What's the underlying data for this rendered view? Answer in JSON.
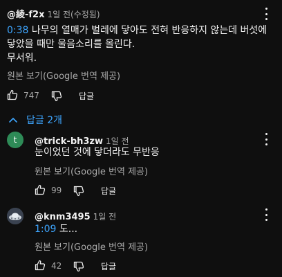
{
  "comment": {
    "author": "@綾-f2x",
    "meta": "1일 전(수정됨)",
    "timestamp": "0:38",
    "text_line1": " 나무의 열매가 벌레에 닿아도 전혀 반응하지 않는데 버섯에",
    "text_line2": "닿았을 때만 울음소리를 올린다.",
    "text_line3": "무서워.",
    "translate_label": "원본 보기(Google 번역 제공)",
    "like_count": "747",
    "reply_label": "답글"
  },
  "replies_toggle": {
    "label": "답글 2개"
  },
  "replies": [
    {
      "avatar_letter": "t",
      "avatar_color": "#2e8b57",
      "author": "@trick-bh3zw",
      "meta": "1일 전",
      "text": "눈이었던 것에 닿더라도 무반응",
      "translate_label": "원본 보기(Google 번역 제공)",
      "like_count": "99",
      "reply_label": "답글"
    },
    {
      "author": "@knm3495",
      "meta": "1일 전",
      "timestamp": "1:09",
      "text": " 도...",
      "translate_label": "원본 보기(Google 번역 제공)",
      "like_count": "42",
      "reply_label": "답글"
    }
  ]
}
